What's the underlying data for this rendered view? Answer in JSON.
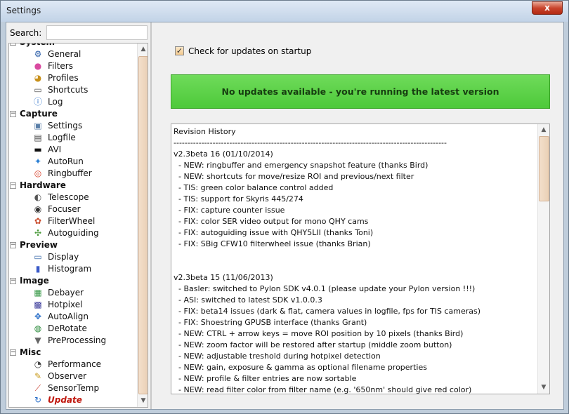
{
  "window": {
    "title": "Settings",
    "close_label": "x"
  },
  "search": {
    "label": "Search:",
    "value": ""
  },
  "tree": {
    "categories": [
      {
        "label": "System",
        "items": [
          {
            "label": "General",
            "icon": "gear-icon"
          },
          {
            "label": "Filters",
            "icon": "color-wheel-icon"
          },
          {
            "label": "Profiles",
            "icon": "profiles-icon"
          },
          {
            "label": "Shortcuts",
            "icon": "keyboard-icon"
          },
          {
            "label": "Log",
            "icon": "info-icon"
          }
        ]
      },
      {
        "label": "Capture",
        "items": [
          {
            "label": "Settings",
            "icon": "settings-window-icon"
          },
          {
            "label": "Logfile",
            "icon": "logfile-icon"
          },
          {
            "label": "AVI",
            "icon": "avi-icon"
          },
          {
            "label": "AutoRun",
            "icon": "running-man-icon"
          },
          {
            "label": "Ringbuffer",
            "icon": "lifebuoy-icon"
          }
        ]
      },
      {
        "label": "Hardware",
        "items": [
          {
            "label": "Telescope",
            "icon": "telescope-icon"
          },
          {
            "label": "Focuser",
            "icon": "focuser-icon"
          },
          {
            "label": "FilterWheel",
            "icon": "filterwheel-icon"
          },
          {
            "label": "Autoguiding",
            "icon": "autoguiding-icon"
          }
        ]
      },
      {
        "label": "Preview",
        "items": [
          {
            "label": "Display",
            "icon": "monitor-icon"
          },
          {
            "label": "Histogram",
            "icon": "histogram-icon"
          }
        ]
      },
      {
        "label": "Image",
        "items": [
          {
            "label": "Debayer",
            "icon": "bayer-grid-icon"
          },
          {
            "label": "Hotpixel",
            "icon": "hotpixel-icon"
          },
          {
            "label": "AutoAlign",
            "icon": "align-icon"
          },
          {
            "label": "DeRotate",
            "icon": "globe-icon"
          },
          {
            "label": "PreProcessing",
            "icon": "funnel-icon"
          }
        ]
      },
      {
        "label": "Misc",
        "items": [
          {
            "label": "Performance",
            "icon": "speedometer-icon"
          },
          {
            "label": "Observer",
            "icon": "pencil-icon"
          },
          {
            "label": "SensorTemp",
            "icon": "thermometer-icon"
          },
          {
            "label": "Update",
            "icon": "update-icon",
            "selected": true
          }
        ]
      }
    ]
  },
  "update": {
    "check_on_startup_label": "Check for updates on startup",
    "check_on_startup_checked": true,
    "status_message": "No updates available - you're running the latest version"
  },
  "history": {
    "lines": [
      "Revision History",
      "--------------------------------------------------------------------------------------------------",
      "v2.3beta 16 (01/10/2014)",
      "  - NEW: ringbuffer and emergency snapshot feature (thanks Bird)",
      "  - NEW: shortcuts for move/resize ROI and previous/next filter",
      "  - TIS: green color balance control added",
      "  - TIS: support for Skyris 445/274",
      "  - FIX: capture counter issue",
      "  - FIX: color SER video output for mono QHY cams",
      "  - FIX: autoguiding issue with QHY5LII (thanks Toni)",
      "  - FIX: SBig CFW10 filterwheel issue (thanks Brian)",
      "",
      "",
      "v2.3beta 15 (11/06/2013)",
      "  - Basler: switched to Pylon SDK v4.0.1 (please update your Pylon version !!!)",
      "  - ASI: switched to latest SDK v1.0.0.3",
      "  - FIX: beta14 issues (dark & flat, camera values in logfile, fps for TIS cameras)",
      "  - FIX: Shoestring GPUSB interface (thanks Grant)",
      "  - NEW: CTRL + arrow keys = move ROI position by 10 pixels (thanks Bird)",
      "  - NEW: zoom factor will be restored after startup (middle zoom button)",
      "  - NEW: adjustable treshold during hotpixel detection",
      "  - NEW: gain, exposure & gamma as optional filename properties",
      "  - NEW: profile & filter entries are now sortable",
      "  - NEW: read filter color from filter name (e.g. '650nm' should give red color)"
    ]
  }
}
